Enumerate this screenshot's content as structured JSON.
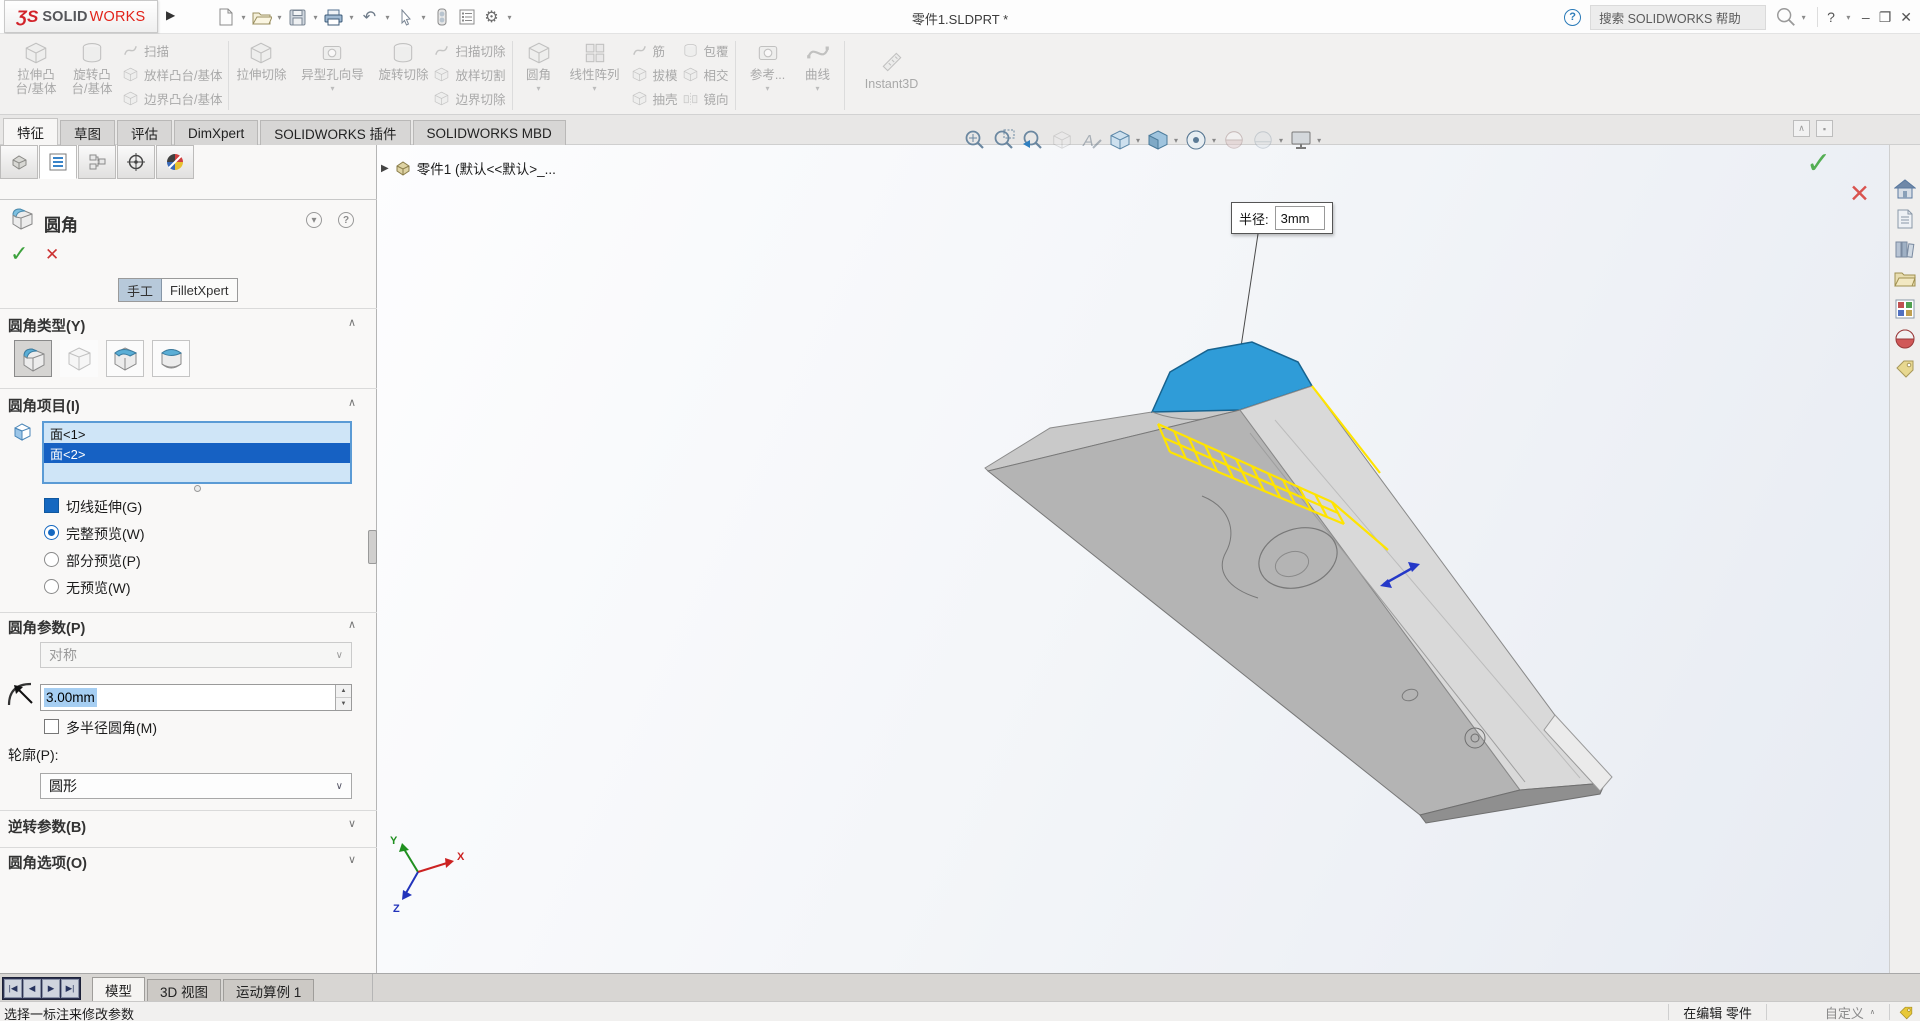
{
  "glyphs": {
    "dropdown": "▾",
    "section_open": "∧",
    "section_closed": "∨",
    "combo_down": "∨",
    "ok": "✓",
    "cancel": "✕",
    "help": "?",
    "minimize": "–",
    "restore": "❐",
    "close": "✕",
    "menu_arrow": "▶",
    "flyout_arrow": "▶",
    "undo": "↶",
    "gear": "⚙",
    "spin_up": "▲",
    "spin_down": "▼",
    "collapse_box": "∧",
    "pin_box": "▪"
  },
  "titlebar": {
    "brand_ds": "ƷS",
    "brand_solid": "SOLID",
    "brand_works": "WORKS",
    "document_title": "零件1.SLDPRT *",
    "search_placeholder": "搜索 SOLIDWORKS 帮助"
  },
  "ribbon": {
    "boss_extrude": "拉伸凸台/基体",
    "revolve_boss": "旋转凸台/基体",
    "sweep": "扫描",
    "loft": "放样凸台/基体",
    "boundary_boss": "边界凸台/基体",
    "cut_extrude": "拉伸切除",
    "hole_wizard": "异型孔向导",
    "revolve_cut": "旋转切除",
    "sweep_cut": "扫描切除",
    "loft_cut": "放样切割",
    "boundary_cut": "边界切除",
    "fillet": "圆角",
    "linear_pattern": "线性阵列",
    "rib": "筋",
    "draft": "拔模",
    "shell": "抽壳",
    "wrap": "包覆",
    "intersect": "相交",
    "mirror": "镜向",
    "reference": "参考...",
    "curves": "曲线",
    "instant3d": "Instant3D"
  },
  "command_tabs": [
    {
      "label": "特征"
    },
    {
      "label": "草图"
    },
    {
      "label": "评估"
    },
    {
      "label": "DimXpert"
    },
    {
      "label": "SOLIDWORKS 插件"
    },
    {
      "label": "SOLIDWORKS MBD"
    }
  ],
  "pm": {
    "title": "圆角",
    "mode_manual": "手工",
    "mode_expert": "FilletXpert",
    "sec_type": "圆角类型(Y)",
    "sec_items": "圆角项目(I)",
    "faces": [
      "面<1>",
      "面<2>"
    ],
    "tangent": "切线延伸(G)",
    "preview_full": "完整预览(W)",
    "preview_partial": "部分预览(P)",
    "preview_none": "无预览(W)",
    "sec_params": "圆角参数(P)",
    "symmetric": "对称",
    "radius_value": "3.00mm",
    "multi_radius": "多半径圆角(M)",
    "profile_label": "轮廓(P):",
    "profile_value": "圆形",
    "sec_setback": "逆转参数(B)",
    "sec_options": "圆角选项(O)"
  },
  "viewport": {
    "tree_root": "零件1 (默认<<默认>_...",
    "callout_label": "半径:",
    "callout_value": "3mm",
    "axis_x": "X",
    "axis_y": "Y",
    "axis_z": "Z"
  },
  "motion": {
    "vcr": [
      "|◀",
      "◀",
      "▶",
      "▶|"
    ],
    "tabs": [
      "模型",
      "3D 视图",
      "运动算例 1"
    ]
  },
  "status": {
    "hint": "选择一标注来修改参数",
    "editing": "在编辑 零件",
    "custom": "自定义"
  },
  "colors": {
    "accent_blue": "#1568c0",
    "selection_blue": "#1661c3",
    "preview_yellow": "#ffe400",
    "selected_face_blue": "#2f9cd8",
    "ok_green": "#3da23d",
    "cancel_red": "#cc3333"
  }
}
